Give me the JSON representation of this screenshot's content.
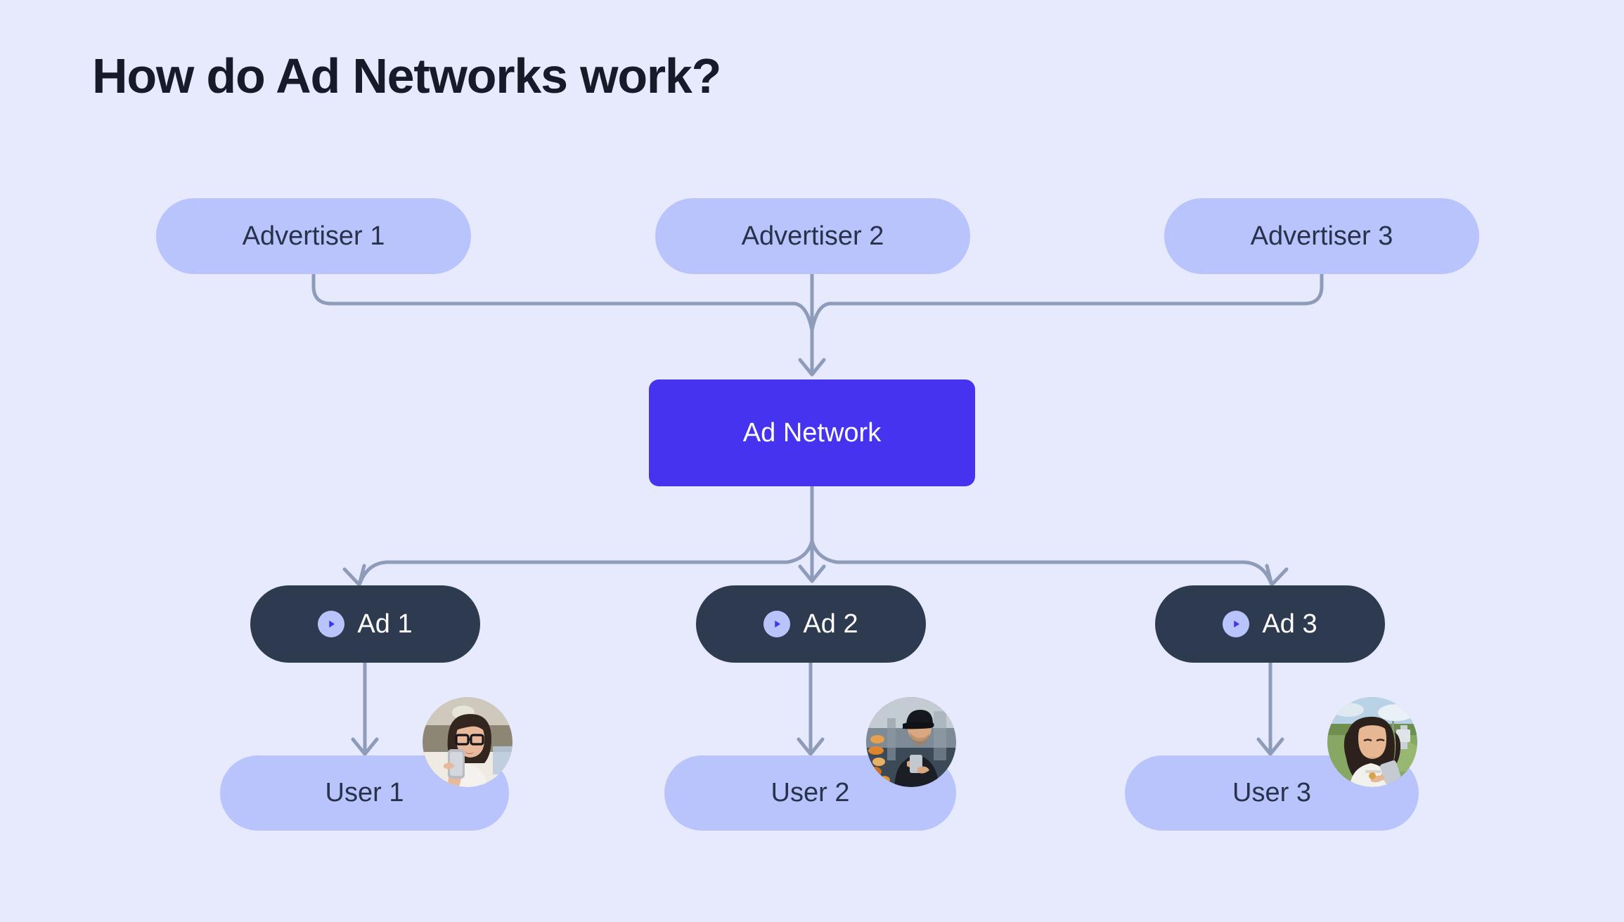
{
  "page": {
    "title": "How do Ad Networks work?",
    "background_color": "#e6eafc",
    "title_color": "#161a29"
  },
  "colors": {
    "pill_light": "#b8c4fb",
    "pill_dark": "#2e3a4f",
    "accent": "#4533f0",
    "connector": "#8e9cba",
    "text_dark": "#29324a",
    "text_light": "#ffffff"
  },
  "diagram": {
    "type": "flow-diagram",
    "advertisers": [
      {
        "label": "Advertiser 1"
      },
      {
        "label": "Advertiser 2"
      },
      {
        "label": "Advertiser 3"
      }
    ],
    "hub": {
      "label": "Ad Network"
    },
    "ads": [
      {
        "label": "Ad 1",
        "icon": "play-icon"
      },
      {
        "label": "Ad 2",
        "icon": "play-icon"
      },
      {
        "label": "Ad 3",
        "icon": "play-icon"
      }
    ],
    "users": [
      {
        "label": "User 1",
        "avatar": "woman-with-glasses-holding-phone"
      },
      {
        "label": "User 2",
        "avatar": "man-in-cap-using-phone-at-night"
      },
      {
        "label": "User 3",
        "avatar": "woman-outdoors-using-phone"
      }
    ],
    "flow": [
      "Advertiser 1 -> Ad Network",
      "Advertiser 2 -> Ad Network",
      "Advertiser 3 -> Ad Network",
      "Ad Network -> Ad 1",
      "Ad Network -> Ad 2",
      "Ad Network -> Ad 3",
      "Ad 1 -> User 1",
      "Ad 2 -> User 2",
      "Ad 3 -> User 3"
    ]
  }
}
